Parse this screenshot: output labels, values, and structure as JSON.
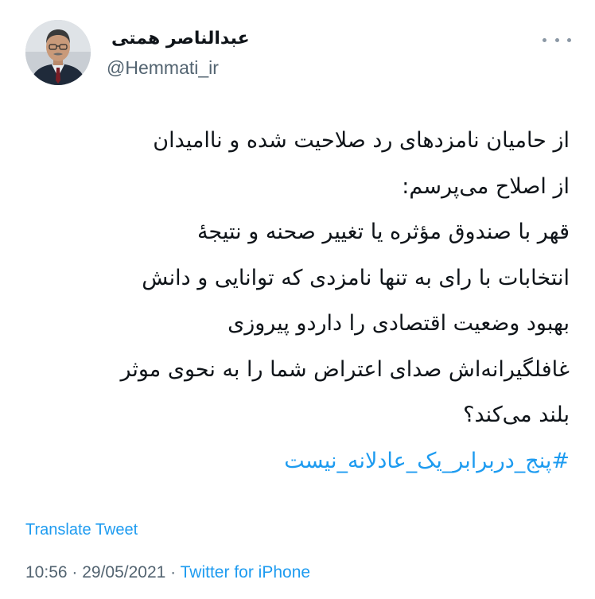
{
  "author": {
    "name": "عبدالناصر همتی",
    "handle": "@Hemmati_ir",
    "avatar_icon": "profile-photo"
  },
  "more_icon": "more-options-icon",
  "tweet": {
    "lines": [
      "از حامیان نامزدهای رد صلاحیت شده و ناامیدان",
      "از اصلاح می‌پرسم:",
      "قهر با صندوق مؤثره یا تغییر صحنه و نتیجهٔ",
      "انتخابات با رای به تنها نامزدی که توانایی و دانش",
      "بهبود وضعیت اقتصادی را داردو پیروزی",
      "غافلگیرانه‌اش صدای اعتراض شما را به نحوی موثر",
      "بلند می‌کند؟"
    ],
    "hashtag": "#پنج_دربرابر_یک_عادلانه_نیست"
  },
  "translate_label": "Translate Tweet",
  "meta": {
    "time": "10:56",
    "separator1": " · ",
    "date": "29/05/2021",
    "separator2": " · ",
    "source": "Twitter for iPhone"
  },
  "colors": {
    "link": "#1d9bf0",
    "secondary_text": "#536471",
    "primary_text": "#0f1419"
  }
}
